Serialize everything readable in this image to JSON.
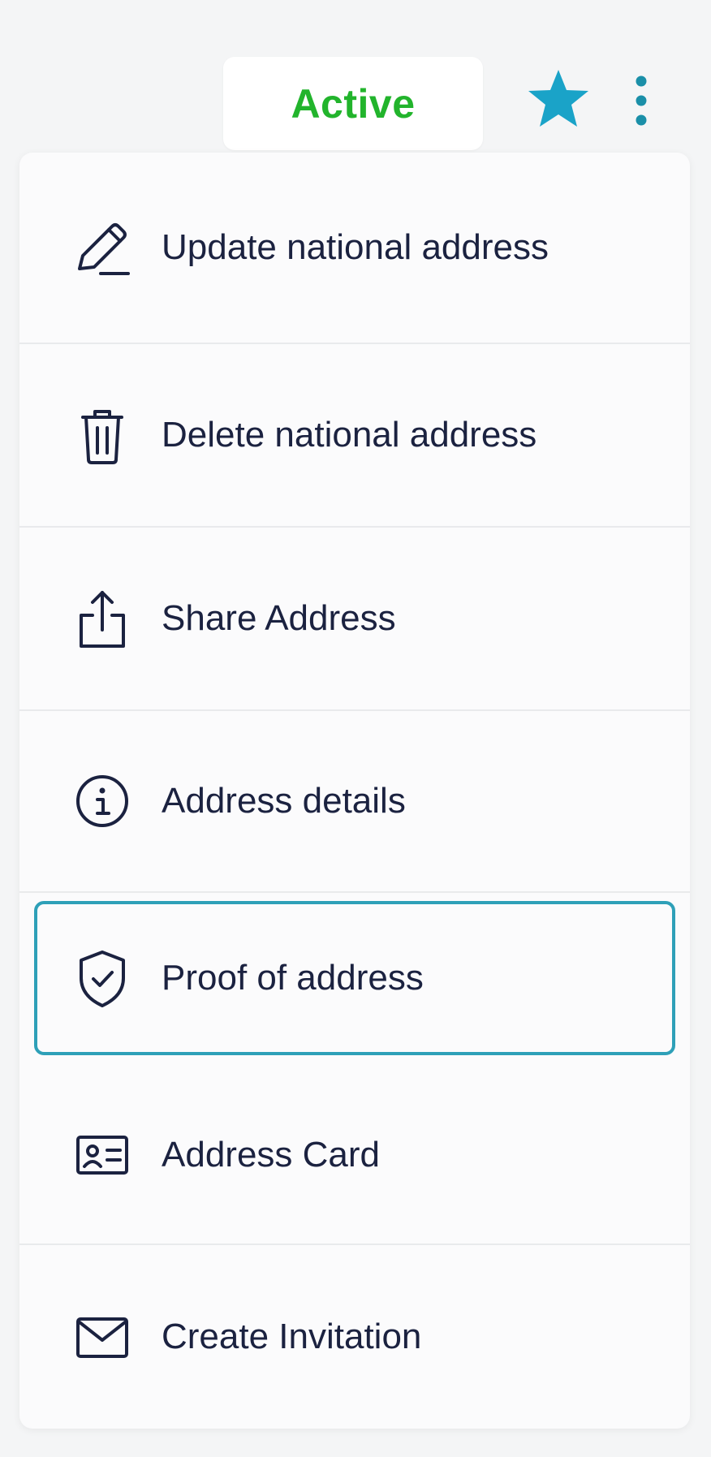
{
  "header": {
    "status_label": "Active",
    "status_color": "#22b42c",
    "favorite_icon": "star-icon",
    "favorite_color": "#1aa3c8",
    "more_icon": "more-vertical-icon"
  },
  "menu": {
    "selected_index": 4,
    "accent_color": "#2ea0b8",
    "items": [
      {
        "label": "Update national address",
        "icon": "pencil-icon"
      },
      {
        "label": "Delete national address",
        "icon": "trash-icon"
      },
      {
        "label": "Share Address",
        "icon": "share-icon"
      },
      {
        "label": "Address details",
        "icon": "info-icon"
      },
      {
        "label": "Proof of address",
        "icon": "shield-check-icon"
      },
      {
        "label": "Address Card",
        "icon": "id-card-icon"
      },
      {
        "label": "Create Invitation",
        "icon": "envelope-icon"
      }
    ]
  }
}
